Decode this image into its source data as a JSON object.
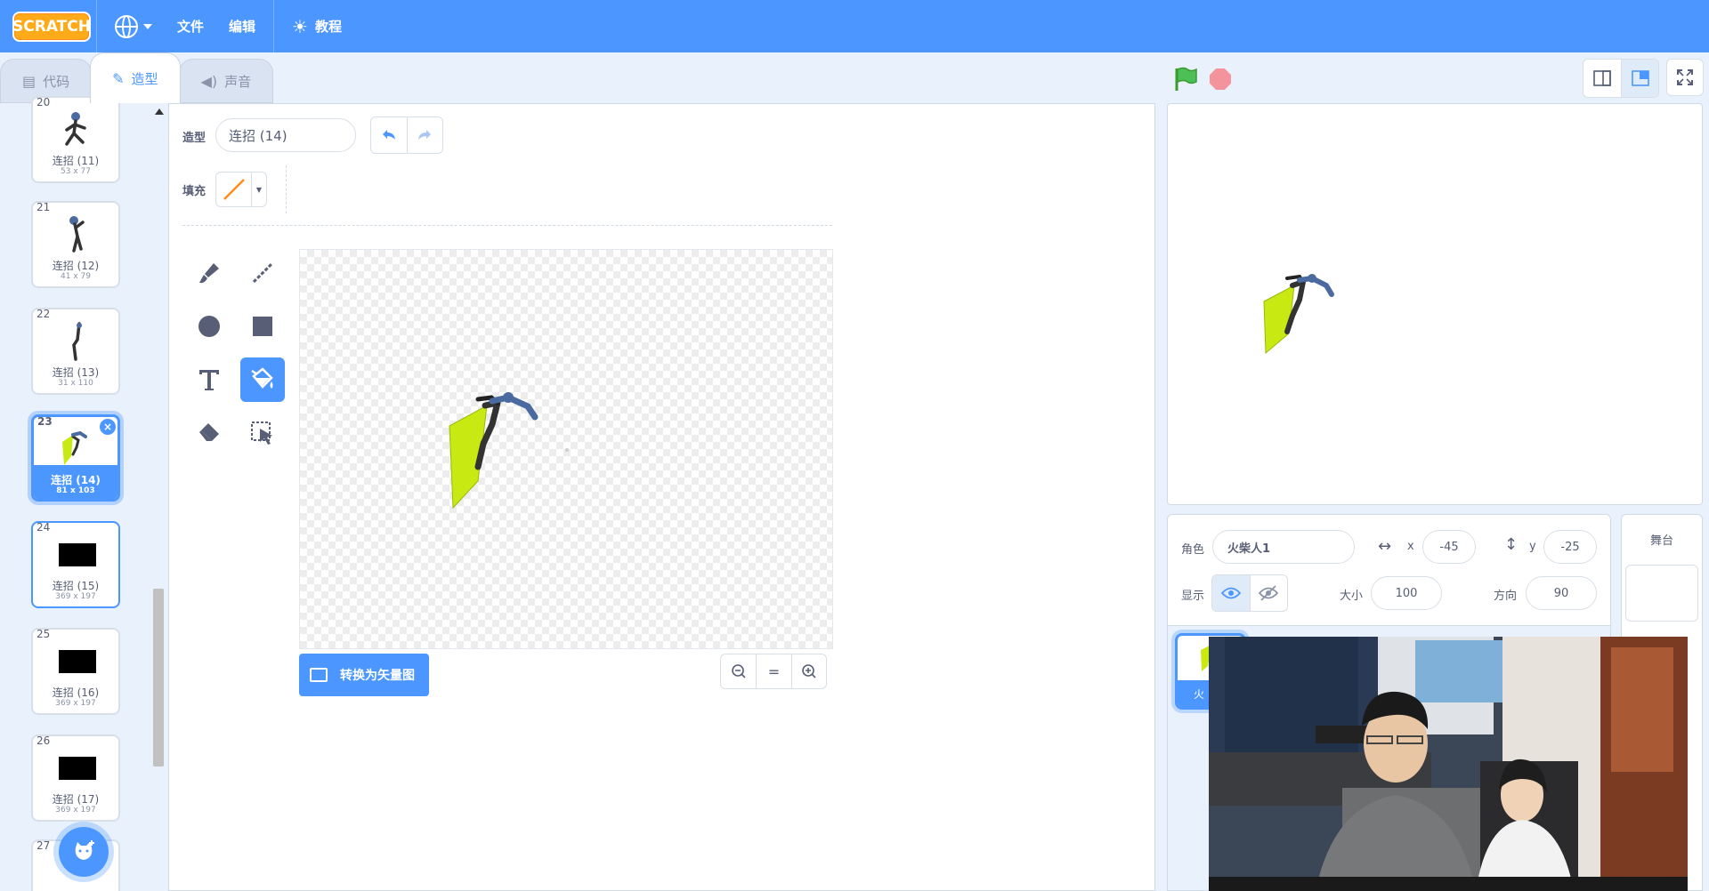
{
  "menu": {
    "logo": "SCRATCH",
    "file": "文件",
    "edit": "编辑",
    "tutorials": "教程"
  },
  "tabs": [
    {
      "label": "代码",
      "icon": "code-icon"
    },
    {
      "label": "造型",
      "icon": "brush-icon"
    },
    {
      "label": "声音",
      "icon": "speaker-icon"
    }
  ],
  "costumes": [
    {
      "num": "20",
      "name": "连招 (11)",
      "size": "53 x 77"
    },
    {
      "num": "21",
      "name": "连招 (12)",
      "size": "41 x 79"
    },
    {
      "num": "22",
      "name": "连招 (13)",
      "size": "31 x 110"
    },
    {
      "num": "23",
      "name": "连招 (14)",
      "size": "81 x 103"
    },
    {
      "num": "24",
      "name": "连招 (15)",
      "size": "369 x 197"
    },
    {
      "num": "25",
      "name": "连招 (16)",
      "size": "369 x 197"
    },
    {
      "num": "26",
      "name": "连招 (17)",
      "size": "369 x 197"
    },
    {
      "num": "27"
    }
  ],
  "editor": {
    "costume_label": "造型",
    "costume_name": "连招 (14)",
    "fill_label": "填充",
    "fill_color": "#ff8c1a",
    "convert_button": "转换为矢量图",
    "zoom_reset": "="
  },
  "sprite": {
    "sprite_label": "角色",
    "sprite_name": "火柴人1",
    "x_label": "x",
    "x": "-45",
    "y_label": "y",
    "y": "-25",
    "show_label": "显示",
    "size_label": "大小",
    "size": "100",
    "direction_label": "方向",
    "direction": "90"
  },
  "stage_pane": {
    "title": "舞台"
  },
  "sprite_tile": {
    "name": "火"
  },
  "colors": {
    "menu": "#4c97ff",
    "accent": "#4c97ff",
    "costume_green": "#c8ea12",
    "stickman": "#3a3a3a",
    "stickman_blue": "#4a6aa0"
  }
}
